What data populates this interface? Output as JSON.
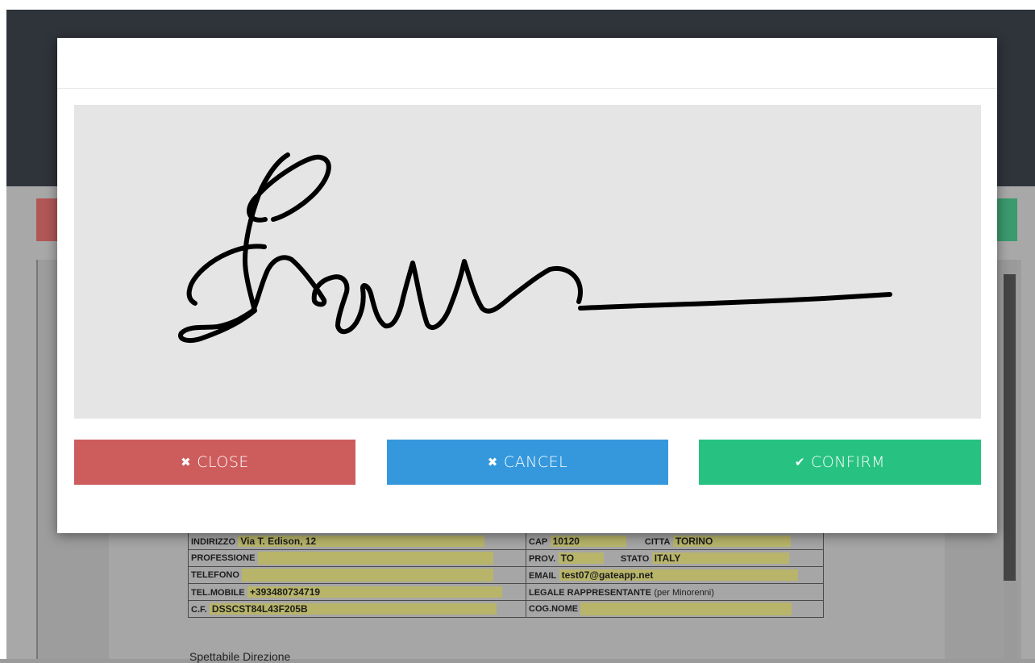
{
  "modal": {
    "buttons": {
      "close": {
        "icon": "times-icon",
        "icon_glyph": "✖",
        "label": "CLOSE",
        "color": "#cd5c5c"
      },
      "cancel": {
        "icon": "times-icon",
        "icon_glyph": "✖",
        "label": "CANCEL",
        "color": "#3598dc"
      },
      "confirm": {
        "icon": "check-icon",
        "icon_glyph": "✔",
        "label": "CONFIRM",
        "color": "#27c281"
      }
    }
  },
  "form": {
    "indirizzo": {
      "label": "INDIRIZZO",
      "value": "Via T. Edison, 12"
    },
    "cap": {
      "label": "CAP",
      "value": "10120"
    },
    "citta": {
      "label": "CITTA",
      "value": "TORINO"
    },
    "professione": {
      "label": "PROFESSIONE",
      "value": ""
    },
    "prov": {
      "label": "PROV.",
      "value": "TO"
    },
    "stato": {
      "label": "STATO",
      "value": "ITALY"
    },
    "telefono": {
      "label": "TELEFONO",
      "value": ""
    },
    "email": {
      "label": "EMAIL",
      "value": "test07@gateapp.net"
    },
    "tel_mobile": {
      "label": "TEL.MOBILE",
      "value": "+393480734719"
    },
    "legale": {
      "label": "LEGALE RAPPRESENTANTE",
      "note": "(per Minorenni)"
    },
    "cf": {
      "label": "C.F.",
      "value": "DSSCST84L43F205B"
    },
    "cog_nome": {
      "label": "COG.NOME",
      "value": ""
    }
  },
  "document": {
    "partial_text": "Spettabile Direzione"
  }
}
